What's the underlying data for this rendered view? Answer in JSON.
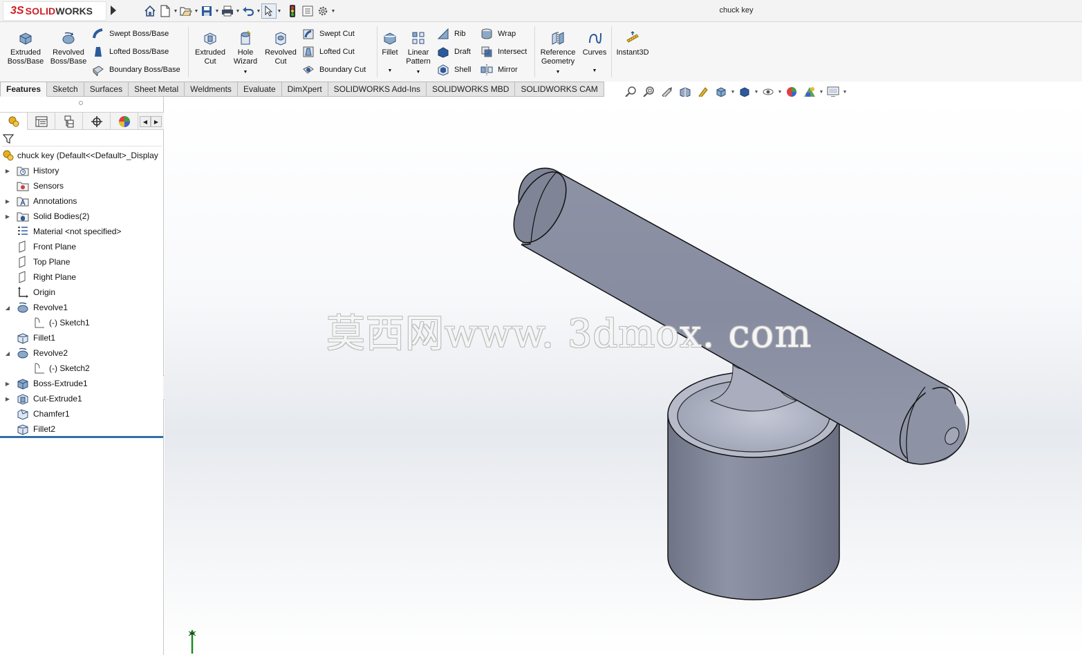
{
  "app": {
    "brand_ds": "3S",
    "brand_solid": "SOLID",
    "brand_works": "WORKS",
    "document_title": "chuck key"
  },
  "colors": {
    "brand_red": "#cc1d22",
    "model_gray": "#8d91a2",
    "rollback_blue": "#2f6fa8",
    "model_edge": "#1a1a1a"
  },
  "quick_access": [
    {
      "name": "home-icon",
      "dropdown": false
    },
    {
      "name": "new-document-icon",
      "dropdown": true
    },
    {
      "name": "open-icon",
      "dropdown": true
    },
    {
      "name": "save-icon",
      "dropdown": true
    },
    {
      "name": "print-icon",
      "dropdown": true
    },
    {
      "name": "undo-icon",
      "dropdown": true
    },
    {
      "name": "select-icon",
      "dropdown": true
    },
    {
      "name": "rebuild-icon",
      "dropdown": false
    },
    {
      "name": "file-properties-icon",
      "dropdown": false
    },
    {
      "name": "options-icon",
      "dropdown": true
    }
  ],
  "commands": {
    "extruded_boss": "Extruded\nBoss/Base",
    "revolved_boss": "Revolved\nBoss/Base",
    "swept_boss": "Swept Boss/Base",
    "lofted_boss": "Lofted Boss/Base",
    "boundary_boss": "Boundary Boss/Base",
    "extruded_cut": "Extruded\nCut",
    "hole_wizard": "Hole\nWizard",
    "revolved_cut": "Revolved\nCut",
    "swept_cut": "Swept Cut",
    "lofted_cut": "Lofted Cut",
    "boundary_cut": "Boundary Cut",
    "fillet": "Fillet",
    "linear_pattern": "Linear\nPattern",
    "rib": "Rib",
    "draft": "Draft",
    "shell": "Shell",
    "wrap": "Wrap",
    "intersect": "Intersect",
    "mirror": "Mirror",
    "reference_geometry": "Reference\nGeometry",
    "curves": "Curves",
    "instant3d": "Instant3D"
  },
  "tabs": [
    {
      "label": "Features",
      "active": true
    },
    {
      "label": "Sketch",
      "active": false
    },
    {
      "label": "Surfaces",
      "active": false
    },
    {
      "label": "Sheet Metal",
      "active": false
    },
    {
      "label": "Weldments",
      "active": false
    },
    {
      "label": "Evaluate",
      "active": false
    },
    {
      "label": "DimXpert",
      "active": false
    },
    {
      "label": "SOLIDWORKS Add-Ins",
      "active": false
    },
    {
      "label": "SOLIDWORKS MBD",
      "active": false
    },
    {
      "label": "SOLIDWORKS CAM",
      "active": false
    }
  ],
  "heads_up": [
    {
      "name": "zoom-to-fit-icon",
      "dropdown": false
    },
    {
      "name": "zoom-to-area-icon",
      "dropdown": false
    },
    {
      "name": "previous-view-icon",
      "dropdown": false
    },
    {
      "name": "section-view-icon",
      "dropdown": false
    },
    {
      "name": "dynamic-annotation-icon",
      "dropdown": false
    },
    {
      "name": "view-orientation-icon",
      "dropdown": true
    },
    {
      "name": "display-style-icon",
      "dropdown": true
    },
    {
      "name": "hide-show-items-icon",
      "dropdown": true
    },
    {
      "name": "edit-appearance-icon",
      "dropdown": false
    },
    {
      "name": "apply-scene-icon",
      "dropdown": true
    },
    {
      "name": "view-settings-icon",
      "dropdown": true
    }
  ],
  "panel_tabs": [
    {
      "name": "featuremanager-tab",
      "active": true
    },
    {
      "name": "propertymanager-tab",
      "active": false
    },
    {
      "name": "configurationmanager-tab",
      "active": false
    },
    {
      "name": "dimxpertmanager-tab",
      "active": false
    },
    {
      "name": "displaymanager-tab",
      "active": false
    }
  ],
  "feature_tree": {
    "root": "chuck key  (Default<<Default>_Display",
    "items": [
      {
        "label": "History",
        "icon": "history-folder-icon",
        "expandable": true,
        "expanded": false,
        "child": false
      },
      {
        "label": "Sensors",
        "icon": "sensors-folder-icon",
        "expandable": false,
        "expanded": false,
        "child": false
      },
      {
        "label": "Annotations",
        "icon": "annotations-folder-icon",
        "expandable": true,
        "expanded": false,
        "child": false
      },
      {
        "label": "Solid Bodies(2)",
        "icon": "solid-bodies-folder-icon",
        "expandable": true,
        "expanded": false,
        "child": false
      },
      {
        "label": "Material <not specified>",
        "icon": "material-icon",
        "expandable": false,
        "expanded": false,
        "child": false
      },
      {
        "label": "Front Plane",
        "icon": "plane-icon",
        "expandable": false,
        "expanded": false,
        "child": false
      },
      {
        "label": "Top Plane",
        "icon": "plane-icon",
        "expandable": false,
        "expanded": false,
        "child": false
      },
      {
        "label": "Right Plane",
        "icon": "plane-icon",
        "expandable": false,
        "expanded": false,
        "child": false
      },
      {
        "label": "Origin",
        "icon": "origin-icon",
        "expandable": false,
        "expanded": false,
        "child": false
      },
      {
        "label": "Revolve1",
        "icon": "revolve-icon",
        "expandable": true,
        "expanded": true,
        "child": false
      },
      {
        "label": "(-) Sketch1",
        "icon": "sketch-icon",
        "expandable": false,
        "expanded": false,
        "child": true
      },
      {
        "label": "Fillet1",
        "icon": "fillet-icon",
        "expandable": false,
        "expanded": false,
        "child": false
      },
      {
        "label": "Revolve2",
        "icon": "revolve-icon",
        "expandable": true,
        "expanded": true,
        "child": false
      },
      {
        "label": "(-) Sketch2",
        "icon": "sketch-icon",
        "expandable": false,
        "expanded": false,
        "child": true
      },
      {
        "label": "Boss-Extrude1",
        "icon": "extrude-icon",
        "expandable": true,
        "expanded": false,
        "child": false
      },
      {
        "label": "Cut-Extrude1",
        "icon": "cut-extrude-icon",
        "expandable": true,
        "expanded": false,
        "child": false
      },
      {
        "label": "Chamfer1",
        "icon": "chamfer-icon",
        "expandable": false,
        "expanded": false,
        "child": false
      },
      {
        "label": "Fillet2",
        "icon": "fillet-icon",
        "expandable": false,
        "expanded": false,
        "child": false
      }
    ]
  },
  "watermark": "莫西网www. 3dmox. com"
}
